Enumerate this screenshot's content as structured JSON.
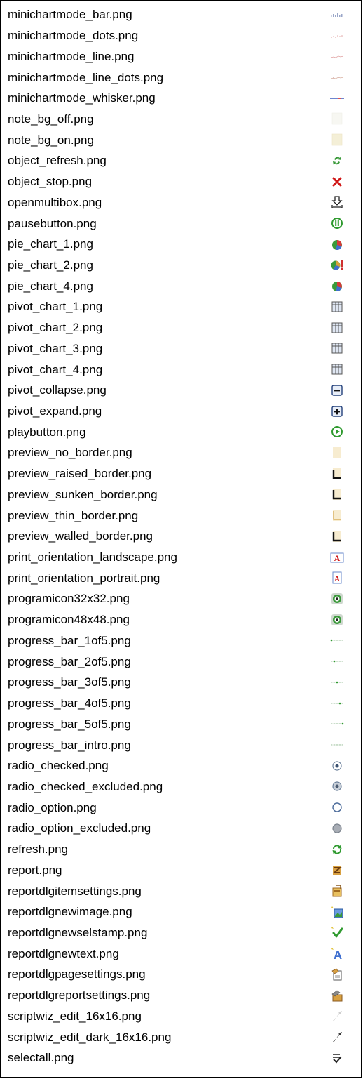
{
  "files": [
    {
      "name": "minichartmode_bar.png",
      "icon": "minichart-bar-icon"
    },
    {
      "name": "minichartmode_dots.png",
      "icon": "minichart-dots-icon"
    },
    {
      "name": "minichartmode_line.png",
      "icon": "minichart-line-icon"
    },
    {
      "name": "minichartmode_line_dots.png",
      "icon": "minichart-line-dots-icon"
    },
    {
      "name": "minichartmode_whisker.png",
      "icon": "minichart-whisker-icon"
    },
    {
      "name": "note_bg_off.png",
      "icon": "note-bg-off-icon"
    },
    {
      "name": "note_bg_on.png",
      "icon": "note-bg-on-icon"
    },
    {
      "name": "object_refresh.png",
      "icon": "refresh-arrows-icon"
    },
    {
      "name": "object_stop.png",
      "icon": "red-x-icon"
    },
    {
      "name": "openmultibox.png",
      "icon": "download-tray-icon"
    },
    {
      "name": "pausebutton.png",
      "icon": "pause-circle-icon"
    },
    {
      "name": "pie_chart_1.png",
      "icon": "pie-chart-icon"
    },
    {
      "name": "pie_chart_2.png",
      "icon": "pie-chart-alert-icon"
    },
    {
      "name": "pie_chart_4.png",
      "icon": "pie-chart-icon"
    },
    {
      "name": "pivot_chart_1.png",
      "icon": "pivot-chart-icon"
    },
    {
      "name": "pivot_chart_2.png",
      "icon": "pivot-chart-icon"
    },
    {
      "name": "pivot_chart_3.png",
      "icon": "pivot-chart-icon"
    },
    {
      "name": "pivot_chart_4.png",
      "icon": "pivot-chart-icon"
    },
    {
      "name": "pivot_collapse.png",
      "icon": "minus-box-icon"
    },
    {
      "name": "pivot_expand.png",
      "icon": "plus-box-icon"
    },
    {
      "name": "playbutton.png",
      "icon": "play-circle-icon"
    },
    {
      "name": "preview_no_border.png",
      "icon": "page-no-border-icon"
    },
    {
      "name": "preview_raised_border.png",
      "icon": "page-border-icon"
    },
    {
      "name": "preview_sunken_border.png",
      "icon": "page-border-icon"
    },
    {
      "name": "preview_thin_border.png",
      "icon": "page-thin-border-icon"
    },
    {
      "name": "preview_walled_border.png",
      "icon": "page-border-icon"
    },
    {
      "name": "print_orientation_landscape.png",
      "icon": "letter-a-landscape-icon"
    },
    {
      "name": "print_orientation_portrait.png",
      "icon": "letter-a-portrait-icon"
    },
    {
      "name": "programicon32x32.png",
      "icon": "program-eye-icon"
    },
    {
      "name": "programicon48x48.png",
      "icon": "program-eye-icon"
    },
    {
      "name": "progress_bar_1of5.png",
      "icon": "progress-dots-icon",
      "step": 1
    },
    {
      "name": "progress_bar_2of5.png",
      "icon": "progress-dots-icon",
      "step": 2
    },
    {
      "name": "progress_bar_3of5.png",
      "icon": "progress-dots-icon",
      "step": 3
    },
    {
      "name": "progress_bar_4of5.png",
      "icon": "progress-dots-icon",
      "step": 4
    },
    {
      "name": "progress_bar_5of5.png",
      "icon": "progress-dots-icon",
      "step": 5
    },
    {
      "name": "progress_bar_intro.png",
      "icon": "progress-dots-icon",
      "step": 0
    },
    {
      "name": "radio_checked.png",
      "icon": "radio-checked-icon"
    },
    {
      "name": "radio_checked_excluded.png",
      "icon": "radio-checked-excluded-icon"
    },
    {
      "name": "radio_option.png",
      "icon": "radio-option-icon"
    },
    {
      "name": "radio_option_excluded.png",
      "icon": "radio-option-excluded-icon"
    },
    {
      "name": "refresh.png",
      "icon": "green-refresh-icon"
    },
    {
      "name": "report.png",
      "icon": "report-z-icon"
    },
    {
      "name": "reportdlgitemsettings.png",
      "icon": "report-item-settings-icon"
    },
    {
      "name": "reportdlgnewimage.png",
      "icon": "report-new-image-icon"
    },
    {
      "name": "reportdlgnewselstamp.png",
      "icon": "report-new-stamp-icon"
    },
    {
      "name": "reportdlgnewtext.png",
      "icon": "report-new-text-icon"
    },
    {
      "name": "reportdlgpagesettings.png",
      "icon": "report-page-settings-icon"
    },
    {
      "name": "reportdlgreportsettings.png",
      "icon": "report-settings-icon"
    },
    {
      "name": "scriptwiz_edit_16x16.png",
      "icon": "edit-arrow-light-icon"
    },
    {
      "name": "scriptwiz_edit_dark_16x16.png",
      "icon": "edit-arrow-dark-icon"
    },
    {
      "name": "selectall.png",
      "icon": "select-all-icon"
    }
  ]
}
